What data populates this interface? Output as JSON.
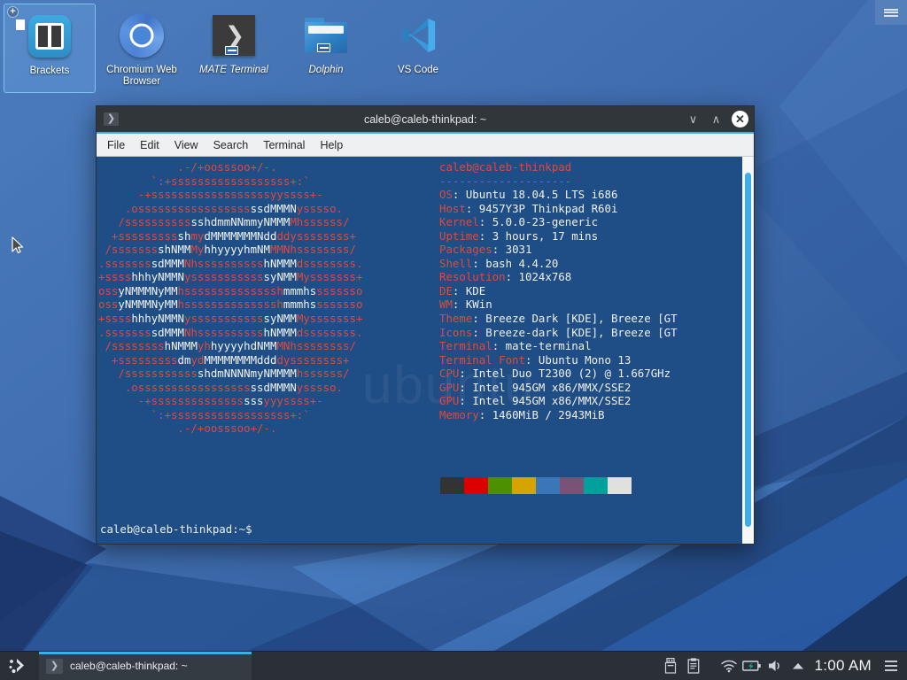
{
  "desktop": {
    "menu_button": "desktop-menu",
    "icons": [
      {
        "label": "Brackets",
        "icon": "brackets-icon",
        "selected": true,
        "italic": false
      },
      {
        "label": "Chromium Web Browser",
        "icon": "chromium-icon",
        "selected": false,
        "italic": false
      },
      {
        "label": "MATE Terminal",
        "icon": "mate-terminal-icon",
        "selected": false,
        "italic": true
      },
      {
        "label": "Dolphin",
        "icon": "dolphin-folder-icon",
        "selected": false,
        "italic": true
      },
      {
        "label": "VS Code",
        "icon": "vscode-icon",
        "selected": false,
        "italic": false
      }
    ]
  },
  "terminal": {
    "title": "caleb@caleb-thinkpad: ~",
    "icon": "terminal-prompt-icon",
    "window_buttons": {
      "minimize": "∨",
      "maximize": "∧",
      "close": "✕"
    },
    "menu": [
      "File",
      "Edit",
      "View",
      "Search",
      "Terminal",
      "Help"
    ],
    "watermark": "ubuntu",
    "prompt": "caleb@caleb-thinkpad:~$",
    "colors": {
      "background": "#1f4e87",
      "ascii_red": "#e0483c",
      "ascii_white": "#f2f2f2",
      "key": "#e0483c",
      "value": "#f0f0f0",
      "accent": "#3daee9"
    },
    "ascii_art": [
      "            .-/+oosssoo+/-.",
      "        `:+ssssssssssssssssss+:`",
      "      -+ssssssssssssssssssyyssss+-",
      "    .osssssssssssssssssssdMMMNysssso.",
      "   /sssssssssssshdmmNNmmyNMMMMhssssss/",
      "  +sssssssssshmydMMMMMMMNddddyssssssss+",
      " /sssssssshNMMMyhhyyyyhmNMMMNhssssssss/",
      ".ssssssssdMMMNhsssssssssshNMMMdssssssss.",
      "+sssshhhyNMMNyssssssssssssyNMMMysssssss+",
      "ossyNMMMNyMMhsssssssssssssshmmmhssssssso",
      "ossyNMMMNyMMhsssssssssssssshmmmhssssssso",
      "+sssshhhyNMMNyssssssssssssyNMMMysssssss+",
      ".ssssssssdMMMNhsssssssssshNMMMdssssssss.",
      " /sssssssshNMMMyhhyyyyhdNMMMNhssssssss/",
      "  +sssssssssdmydMMMMMMMMddddyssssssss+",
      "   /sssssssssssshdmNNNNmyNMMMMhssssss/",
      "    .osssssssssssssssssssdMMMNysssso.",
      "      -+sssssssssssssssssyyyssss+-",
      "        `:+ssssssssssssssssss+:`",
      "            .-/+oosssoo+/-."
    ],
    "ascii_white_spans": [
      [],
      [],
      [],
      [
        [
          23,
          30
        ]
      ],
      [
        [
          14,
          29
        ]
      ],
      [
        [
          12,
          14
        ],
        [
          16,
          27
        ]
      ],
      [
        [
          9,
          14
        ],
        [
          16,
          26
        ]
      ],
      [
        [
          8,
          13
        ],
        [
          25,
          30
        ]
      ],
      [
        [
          5,
          13
        ],
        [
          25,
          30
        ]
      ],
      [
        [
          3,
          12
        ],
        [
          28,
          33
        ]
      ],
      [
        [
          3,
          12
        ],
        [
          28,
          33
        ]
      ],
      [
        [
          5,
          13
        ],
        [
          25,
          30
        ]
      ],
      [
        [
          8,
          13
        ],
        [
          25,
          30
        ]
      ],
      [
        [
          10,
          15
        ],
        [
          17,
          27
        ]
      ],
      [
        [
          12,
          14
        ],
        [
          16,
          27
        ]
      ],
      [
        [
          15,
          30
        ]
      ],
      [
        [
          23,
          30
        ]
      ],
      [
        [
          22,
          25
        ]
      ],
      [],
      []
    ],
    "info": {
      "user_host": "caleb@caleb-thinkpad",
      "divider": "--------------------",
      "rows": [
        {
          "key": "OS",
          "value": "Ubuntu 18.04.5 LTS i686"
        },
        {
          "key": "Host",
          "value": "9457Y3P Thinkpad R60i"
        },
        {
          "key": "Kernel",
          "value": "5.0.0-23-generic"
        },
        {
          "key": "Uptime",
          "value": "3 hours, 17 mins"
        },
        {
          "key": "Packages",
          "value": "3031"
        },
        {
          "key": "Shell",
          "value": "bash 4.4.20"
        },
        {
          "key": "Resolution",
          "value": "1024x768"
        },
        {
          "key": "DE",
          "value": "KDE"
        },
        {
          "key": "WM",
          "value": "KWin"
        },
        {
          "key": "Theme",
          "value": "Breeze Dark [KDE], Breeze [GT"
        },
        {
          "key": "Icons",
          "value": "Breeze-dark [KDE], Breeze [GT"
        },
        {
          "key": "Terminal",
          "value": "mate-terminal"
        },
        {
          "key": "Terminal Font",
          "value": "Ubuntu Mono 13"
        },
        {
          "key": "CPU",
          "value": "Intel Duo T2300 (2) @ 1.667GHz"
        },
        {
          "key": "GPU",
          "value": "Intel 945GM x86/MMX/SSE2"
        },
        {
          "key": "GPU",
          "value": "Intel 945GM x86/MMX/SSE2"
        },
        {
          "key": "Memory",
          "value": "1460MiB / 2943MiB"
        }
      ],
      "palette": [
        "#333333",
        "#dd0000",
        "#4d9100",
        "#d6a300",
        "#3b76b8",
        "#7a5278",
        "#00a19c",
        "#e0e0dc"
      ]
    },
    "scrollbar": {
      "name": "terminal-scrollbar"
    }
  },
  "taskbar": {
    "launcher": "application-launcher",
    "tasks": [
      {
        "label": "caleb@caleb-thinkpad: ~",
        "icon": "terminal-prompt-icon",
        "active": true
      }
    ],
    "tray": [
      {
        "name": "usb-device-icon"
      },
      {
        "name": "clipboard-icon"
      },
      {
        "name": "wifi-icon"
      },
      {
        "name": "battery-charging-icon"
      },
      {
        "name": "volume-icon"
      },
      {
        "name": "show-hidden-tray-icon"
      }
    ],
    "clock": "1:00 AM",
    "menu_button": "tray-menu-button"
  }
}
